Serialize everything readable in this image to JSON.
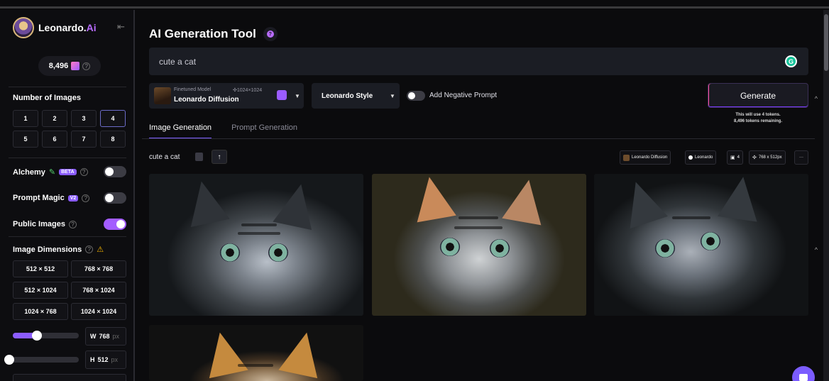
{
  "app": {
    "brand_name": "Leonardo.",
    "brand_suffix": "Ai",
    "token_balance": "8,496"
  },
  "sidebar": {
    "number_of_images": {
      "label": "Number of Images",
      "options": [
        "1",
        "2",
        "3",
        "4",
        "5",
        "6",
        "7",
        "8"
      ],
      "selected": "4"
    },
    "alchemy": {
      "label": "Alchemy",
      "badge": "BETA",
      "enabled": false
    },
    "prompt_magic": {
      "label": "Prompt Magic",
      "badge": "V2",
      "enabled": false
    },
    "public_images": {
      "label": "Public Images",
      "enabled": true
    },
    "image_dimensions": {
      "label": "Image Dimensions",
      "options": [
        "512 × 512",
        "768 × 768",
        "512 × 1024",
        "768 × 1024",
        "1024 × 768",
        "1024 × 1024"
      ],
      "width": {
        "key": "W",
        "value": "768",
        "unit": "px",
        "level": 0.25
      },
      "height": {
        "key": "H",
        "value": "512",
        "unit": "px",
        "level": 0.0
      }
    }
  },
  "main": {
    "title": "AI Generation Tool",
    "prompt_value": "cute a cat",
    "model": {
      "sub_label": "Finetuned Model",
      "size": "1024×1024",
      "name": "Leonardo Diffusion"
    },
    "style": {
      "value": "Leonardo Style"
    },
    "negative_prompt": {
      "label": "Add Negative Prompt",
      "enabled": false
    },
    "generate": {
      "label": "Generate",
      "note_line1": "This will use 4 tokens.",
      "note_line2": "8,496 tokens remaining."
    },
    "tabs": [
      {
        "label": "Image Generation",
        "active": true
      },
      {
        "label": "Prompt Generation",
        "active": false
      }
    ],
    "result": {
      "prompt": "cute a cat",
      "chips": [
        "Leonardo Diffusion",
        "Leonardo",
        "4",
        "768 x 512px",
        "···"
      ]
    }
  },
  "colors": {
    "accent": "#8b5cff",
    "background": "#0b0b0d",
    "panel": "#1b1d24"
  },
  "icons": {
    "collapse": "collapse-sidebar-icon",
    "token": "token-icon",
    "grammarly": "grammarly-icon",
    "chat": "chat-icon"
  }
}
